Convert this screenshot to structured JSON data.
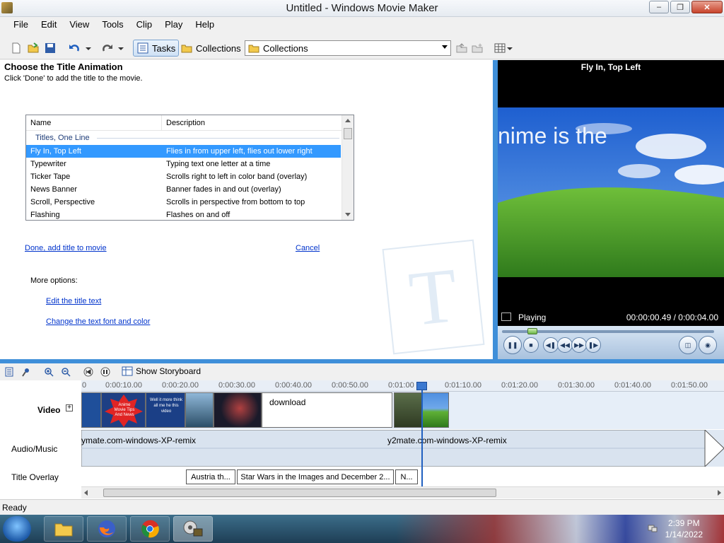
{
  "window": {
    "title": "Untitled - Windows Movie Maker"
  },
  "menu": [
    "File",
    "Edit",
    "View",
    "Tools",
    "Clip",
    "Play",
    "Help"
  ],
  "toolbar": {
    "tasks_label": "Tasks",
    "collections_label": "Collections",
    "collections_combo": "Collections"
  },
  "pane": {
    "heading": "Choose the Title Animation",
    "subheading": "Click 'Done' to add the title to the movie.",
    "columns": [
      "Name",
      "Description"
    ],
    "group": "Titles, One Line",
    "rows": [
      {
        "name": "Fly In, Top Left",
        "desc": "Flies in from upper left, flies out lower right"
      },
      {
        "name": "Typewriter",
        "desc": "Typing text one letter at a time"
      },
      {
        "name": "Ticker Tape",
        "desc": "Scrolls right to left in color band (overlay)"
      },
      {
        "name": "News Banner",
        "desc": "Banner fades in and out (overlay)"
      },
      {
        "name": "Scroll, Perspective",
        "desc": "Scrolls in perspective from bottom to top"
      },
      {
        "name": "Flashing",
        "desc": "Flashes on and off"
      }
    ],
    "done_link": "Done, add title to movie",
    "cancel_link": "Cancel",
    "more_options": "More options:",
    "edit_text_link": "Edit the title text",
    "font_color_link": "Change the text font and color"
  },
  "monitor": {
    "title": "Fly In, Top Left",
    "overlay_text": "nime is the",
    "state": "Playing",
    "time": "00:00:00.49 / 0:00:04.00",
    "progress": 0.12
  },
  "timeline": {
    "show_storyboard": "Show Storyboard",
    "ticks": [
      "0",
      "0:00:10.00",
      "0:00:20.00",
      "0:00:30.00",
      "0:00:40.00",
      "0:00:50.00",
      "0:01:00",
      "0:01:10.00",
      "0:01:20.00",
      "0:01:30.00",
      "0:01:40.00",
      "0:01:50.00"
    ],
    "tracks": {
      "video": "Video",
      "audio": "Audio/Music",
      "title": "Title Overlay"
    },
    "video_clip_download": "download",
    "thumb_text_1": "Anime Movie Tips And News",
    "thumb_text_2": "Well it more think all me he this video",
    "audio_clip_1": "ymate.com-windows-XP-remix",
    "audio_clip_2": "y2mate.com-windows-XP-remix",
    "title_clips": [
      "Austria th...",
      "Star Wars in the Images and December 2...",
      "N..."
    ]
  },
  "status": {
    "text": "Ready"
  },
  "taskbar": {
    "time": "2:39 PM",
    "date": "1/14/2022"
  },
  "colors": {
    "accent": "#3f8fd9",
    "selection": "#3399ff",
    "link": "#0033cc"
  }
}
